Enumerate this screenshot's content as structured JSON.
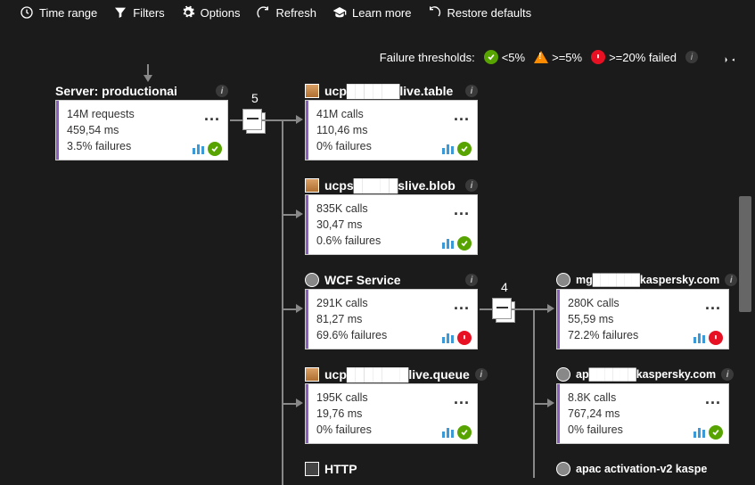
{
  "toolbar": {
    "time_range": "Time range",
    "filters": "Filters",
    "options": "Options",
    "refresh": "Refresh",
    "learn_more": "Learn more",
    "restore_defaults": "Restore defaults"
  },
  "thresholds": {
    "label": "Failure thresholds:",
    "green": "<5%",
    "orange": ">=5%",
    "red": ">=20% failed"
  },
  "nodes": {
    "server": {
      "title": "Server: productionai",
      "requests": "14M requests",
      "latency": "459,54 ms",
      "failures": "3.5% failures",
      "status": "green"
    },
    "table": {
      "title": "ucp██████live.table",
      "calls": "41M calls",
      "latency": "110,46 ms",
      "failures": "0% failures",
      "status": "green"
    },
    "blob": {
      "title": "ucps█████slive.blob",
      "calls": "835K calls",
      "latency": "30,47 ms",
      "failures": "0.6% failures",
      "status": "green"
    },
    "wcf": {
      "title": "WCF Service",
      "calls": "291K calls",
      "latency": "81,27 ms",
      "failures": "69.6% failures",
      "status": "red"
    },
    "queue": {
      "title": "ucp███████live.queue",
      "calls": "195K calls",
      "latency": "19,76 ms",
      "failures": "0% failures",
      "status": "green"
    },
    "http": {
      "title": "HTTP"
    },
    "mgmt": {
      "title": "mg██████kaspersky.com",
      "calls": "280K calls",
      "latency": "55,59 ms",
      "failures": "72.2% failures",
      "status": "red"
    },
    "api": {
      "title": "ap██████kaspersky.com",
      "calls": "8.8K calls",
      "latency": "767,24 ms",
      "failures": "0% failures",
      "status": "green"
    },
    "apac": {
      "title": "apac activation-v2 kaspe"
    }
  },
  "edge_counts": {
    "server_out": "5",
    "wcf_out": "4"
  }
}
